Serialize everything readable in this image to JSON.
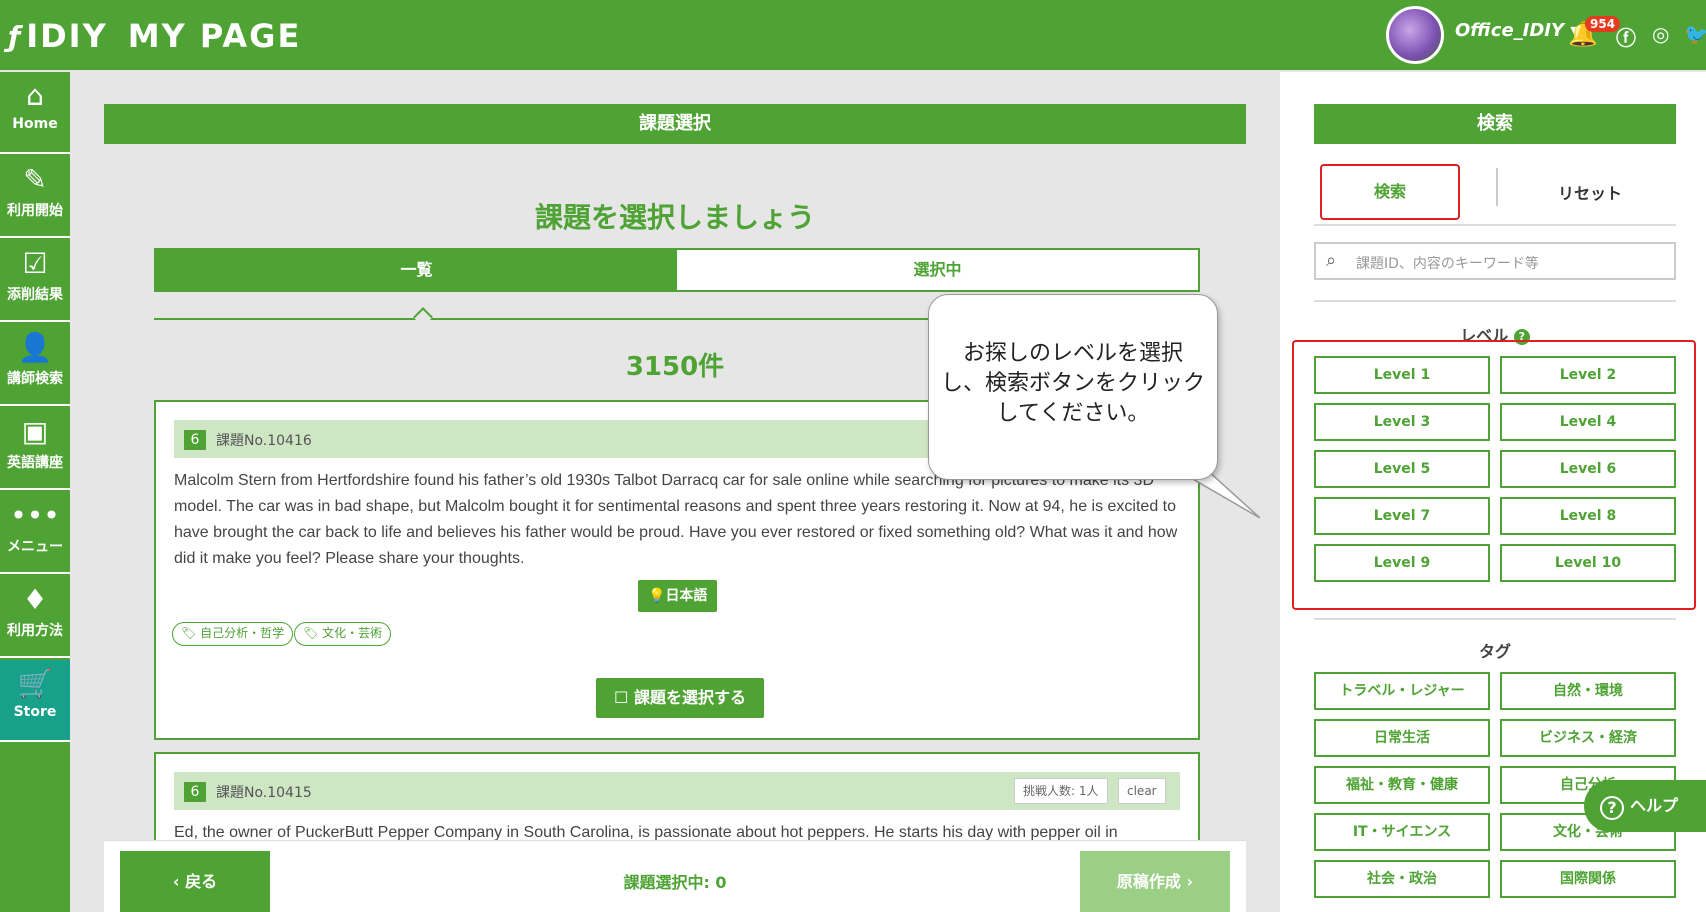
{
  "header": {
    "brand_idiy": "IDIY",
    "brand_mypage": "MY PAGE",
    "username": "Office_IDIY",
    "notification_count": "954"
  },
  "sidebar": {
    "items": [
      {
        "label": "Home",
        "icon": "home-icon"
      },
      {
        "label": "利用開始",
        "icon": "pencil-icon"
      },
      {
        "label": "添削結果",
        "icon": "checkbox-icon"
      },
      {
        "label": "講師検索",
        "icon": "person-icon"
      },
      {
        "label": "英語講座",
        "icon": "video-icon"
      },
      {
        "label": "メニュー",
        "icon": "more-icon"
      },
      {
        "label": "利用方法",
        "icon": "beginner-icon"
      },
      {
        "label": "Store",
        "icon": "cart-icon"
      }
    ]
  },
  "main": {
    "header": "課題選択",
    "title": "課題を選択しましょう",
    "tabs": [
      {
        "label": "一覧"
      },
      {
        "label": "選択中"
      }
    ],
    "count": "3150件",
    "cards": [
      {
        "level": "6",
        "task_no": "課題No.10416",
        "body": "Malcolm Stern from Hertfordshire found his father’s old 1930s Talbot Darracq car for sale online while searching for pictures to make its 3D model. The car was in bad shape, but Malcolm bought it for sentimental reasons and spent three years restoring it. Now at 94, he is excited to have brought the car back to life and believes his father would be proud. Have you ever restored or fixed something old? What was it and how did it make you feel? Please share your thoughts.",
        "language_button": "日本語",
        "tags": [
          "自己分析・哲学",
          "文化・芸術"
        ],
        "select_button": "課題を選択する"
      },
      {
        "level": "6",
        "task_no": "課題No.10415",
        "challengers": "挑戦人数: 1人",
        "clear": "clear",
        "body": "Ed, the owner of PuckerButt Pepper Company in South Carolina, is passionate about hot peppers. He starts his day with pepper oil in"
      }
    ]
  },
  "footer": {
    "back_button": "戻る",
    "selected_count": "課題選択中: 0",
    "draft_button": "原稿作成"
  },
  "search_panel": {
    "header": "検索",
    "search_button": "検索",
    "reset_button": "リセット",
    "keyword_placeholder": "課題ID、内容のキーワード等",
    "level_label": "レベル",
    "levels": [
      "Level 1",
      "Level 2",
      "Level 3",
      "Level 4",
      "Level 5",
      "Level 6",
      "Level 7",
      "Level 8",
      "Level 9",
      "Level 10"
    ],
    "tag_label": "タグ",
    "tags": [
      "トラベル・レジャー",
      "自然・環境",
      "日常生活",
      "ビジネス・経済",
      "福祉・教育・健康",
      "自己分析",
      "IT・サイエンス",
      "文化・芸術",
      "社会・政治",
      "国際関係"
    ]
  },
  "help_button": "ヘルプ",
  "callout": {
    "line1": "お探しのレベルを選択",
    "line2": "し、検索ボタンをクリック",
    "line3": "してください。"
  },
  "colors": {
    "brand_green": "#4ea334",
    "store_teal": "#17a08a",
    "highlight_red": "#e02020"
  }
}
